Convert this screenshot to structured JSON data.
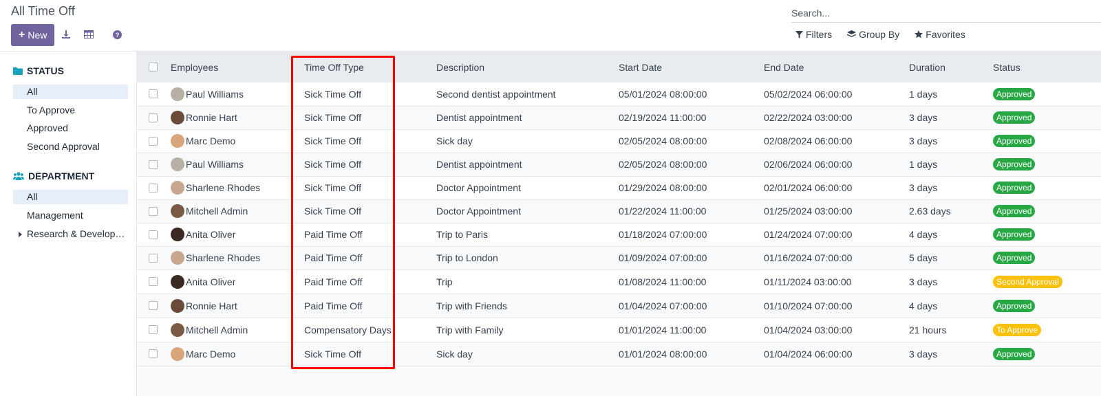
{
  "header": {
    "title": "All Time Off",
    "new_label": "New",
    "search_placeholder": "Search...",
    "filters_label": "Filters",
    "group_by_label": "Group By",
    "favorites_label": "Favorites"
  },
  "sidebar": {
    "status_title": "STATUS",
    "status_items": [
      "All",
      "To Approve",
      "Approved",
      "Second Approval"
    ],
    "department_title": "DEPARTMENT",
    "department_items": [
      "All",
      "Management",
      "Research & Development"
    ]
  },
  "table": {
    "columns": [
      "Employees",
      "Time Off Type",
      "Description",
      "Start Date",
      "End Date",
      "Duration",
      "Status"
    ],
    "rows": [
      {
        "employee": "Paul Williams",
        "type": "Sick Time Off",
        "description": "Second dentist appointment",
        "start": "05/01/2024 08:00:00",
        "end": "05/02/2024 06:00:00",
        "duration": "1 days",
        "status": "Approved"
      },
      {
        "employee": "Ronnie Hart",
        "type": "Sick Time Off",
        "description": "Dentist appointment",
        "start": "02/19/2024 11:00:00",
        "end": "02/22/2024 03:00:00",
        "duration": "3 days",
        "status": "Approved"
      },
      {
        "employee": "Marc Demo",
        "type": "Sick Time Off",
        "description": "Sick day",
        "start": "02/05/2024 08:00:00",
        "end": "02/08/2024 06:00:00",
        "duration": "3 days",
        "status": "Approved"
      },
      {
        "employee": "Paul Williams",
        "type": "Sick Time Off",
        "description": "Dentist appointment",
        "start": "02/05/2024 08:00:00",
        "end": "02/06/2024 06:00:00",
        "duration": "1 days",
        "status": "Approved"
      },
      {
        "employee": "Sharlene Rhodes",
        "type": "Sick Time Off",
        "description": "Doctor Appointment",
        "start": "01/29/2024 08:00:00",
        "end": "02/01/2024 06:00:00",
        "duration": "3 days",
        "status": "Approved"
      },
      {
        "employee": "Mitchell Admin",
        "type": "Sick Time Off",
        "description": "Doctor Appointment",
        "start": "01/22/2024 11:00:00",
        "end": "01/25/2024 03:00:00",
        "duration": "2.63 days",
        "status": "Approved"
      },
      {
        "employee": "Anita Oliver",
        "type": "Paid Time Off",
        "description": "Trip to Paris",
        "start": "01/18/2024 07:00:00",
        "end": "01/24/2024 07:00:00",
        "duration": "4 days",
        "status": "Approved"
      },
      {
        "employee": "Sharlene Rhodes",
        "type": "Paid Time Off",
        "description": "Trip to London",
        "start": "01/09/2024 07:00:00",
        "end": "01/16/2024 07:00:00",
        "duration": "5 days",
        "status": "Approved"
      },
      {
        "employee": "Anita Oliver",
        "type": "Paid Time Off",
        "description": "Trip",
        "start": "01/08/2024 11:00:00",
        "end": "01/11/2024 03:00:00",
        "duration": "3 days",
        "status": "Second Approval"
      },
      {
        "employee": "Ronnie Hart",
        "type": "Paid Time Off",
        "description": "Trip with Friends",
        "start": "01/04/2024 07:00:00",
        "end": "01/10/2024 07:00:00",
        "duration": "4 days",
        "status": "Approved"
      },
      {
        "employee": "Mitchell Admin",
        "type": "Compensatory Days",
        "description": "Trip with Family",
        "start": "01/01/2024 11:00:00",
        "end": "01/04/2024 03:00:00",
        "duration": "21 hours",
        "status": "To Approve"
      },
      {
        "employee": "Marc Demo",
        "type": "Sick Time Off",
        "description": "Sick day",
        "start": "01/01/2024 08:00:00",
        "end": "01/04/2024 06:00:00",
        "duration": "3 days",
        "status": "Approved"
      }
    ]
  },
  "colors": {
    "brand": "#71639e",
    "approved": "#28a745",
    "pending": "#ffc107",
    "highlight": "#ff0000",
    "sidebar_icon": "#17a2b8"
  },
  "icons": [
    "plus-icon",
    "download-icon",
    "table-icon",
    "help-icon",
    "filter-icon",
    "layers-icon",
    "star-icon",
    "folder-icon",
    "users-icon",
    "caret-right-icon"
  ]
}
